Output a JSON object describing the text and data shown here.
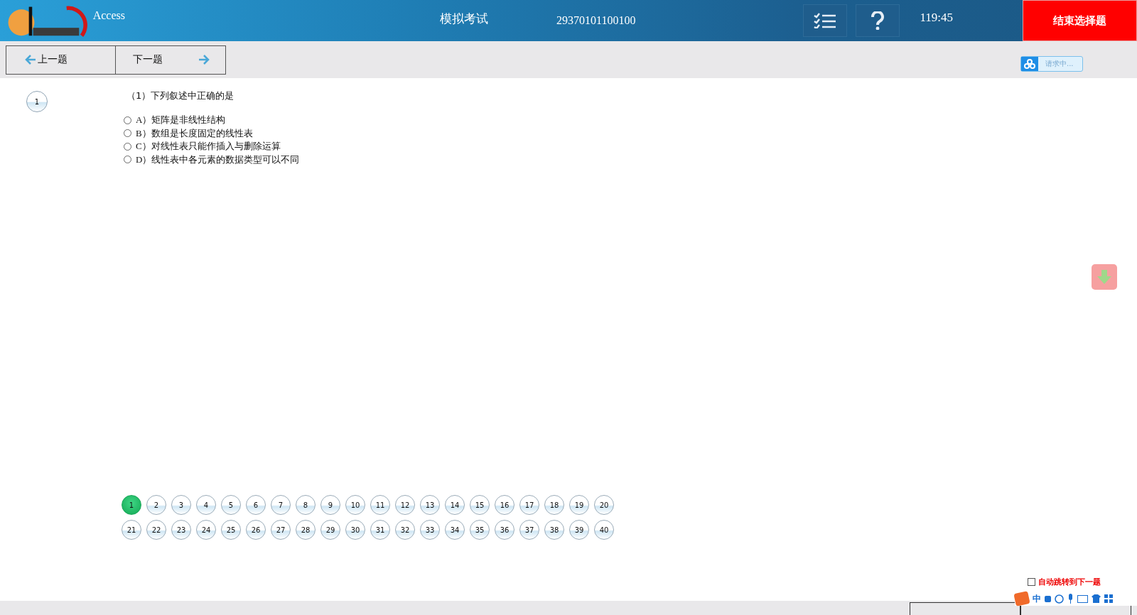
{
  "header": {
    "subject": "Access",
    "title": "模拟考试",
    "exam_number": "29370101100100",
    "timer": "119:45",
    "end_button": "结束选择题"
  },
  "nav": {
    "prev": "上一题",
    "next": "下一题",
    "status": "请求中..."
  },
  "question": {
    "index": "1",
    "prompt": "（1）下列叙述中正确的是",
    "options": [
      {
        "letter": "A）",
        "text": "矩阵是非线性结构",
        "selected": false
      },
      {
        "letter": "B）",
        "text": "数组是长度固定的线性表",
        "selected": false
      },
      {
        "letter": "C）",
        "text": "对线性表只能作插入与删除运算",
        "selected": false
      },
      {
        "letter": "D）",
        "text": "线性表中各元素的数据类型可以不同",
        "selected": false
      }
    ]
  },
  "question_numbers": [
    {
      "label": "1",
      "selected": true
    },
    {
      "label": "2",
      "selected": false
    },
    {
      "label": "3",
      "selected": false
    },
    {
      "label": "4",
      "selected": false
    },
    {
      "label": "5",
      "selected": false
    },
    {
      "label": "6",
      "selected": false
    },
    {
      "label": "7",
      "selected": false
    },
    {
      "label": "8",
      "selected": false
    },
    {
      "label": "9",
      "selected": false
    },
    {
      "label": "10",
      "selected": false
    },
    {
      "label": "11",
      "selected": false
    },
    {
      "label": "12",
      "selected": false
    },
    {
      "label": "13",
      "selected": false
    },
    {
      "label": "14",
      "selected": false
    },
    {
      "label": "15",
      "selected": false
    },
    {
      "label": "16",
      "selected": false
    },
    {
      "label": "17",
      "selected": false
    },
    {
      "label": "18",
      "selected": false
    },
    {
      "label": "19",
      "selected": false
    },
    {
      "label": "20",
      "selected": false
    },
    {
      "label": "21",
      "selected": false
    },
    {
      "label": "22",
      "selected": false
    },
    {
      "label": "23",
      "selected": false
    },
    {
      "label": "24",
      "selected": false
    },
    {
      "label": "25",
      "selected": false
    },
    {
      "label": "26",
      "selected": false
    },
    {
      "label": "27",
      "selected": false
    },
    {
      "label": "28",
      "selected": false
    },
    {
      "label": "29",
      "selected": false
    },
    {
      "label": "30",
      "selected": false
    },
    {
      "label": "31",
      "selected": false
    },
    {
      "label": "32",
      "selected": false
    },
    {
      "label": "33",
      "selected": false
    },
    {
      "label": "34",
      "selected": false
    },
    {
      "label": "35",
      "selected": false
    },
    {
      "label": "36",
      "selected": false
    },
    {
      "label": "37",
      "selected": false
    },
    {
      "label": "38",
      "selected": false
    },
    {
      "label": "39",
      "selected": false
    },
    {
      "label": "40",
      "selected": false
    }
  ],
  "auto_next": {
    "label": "自动跳转到下一题",
    "checked": false
  },
  "ime_bar": {
    "mode": "中"
  }
}
